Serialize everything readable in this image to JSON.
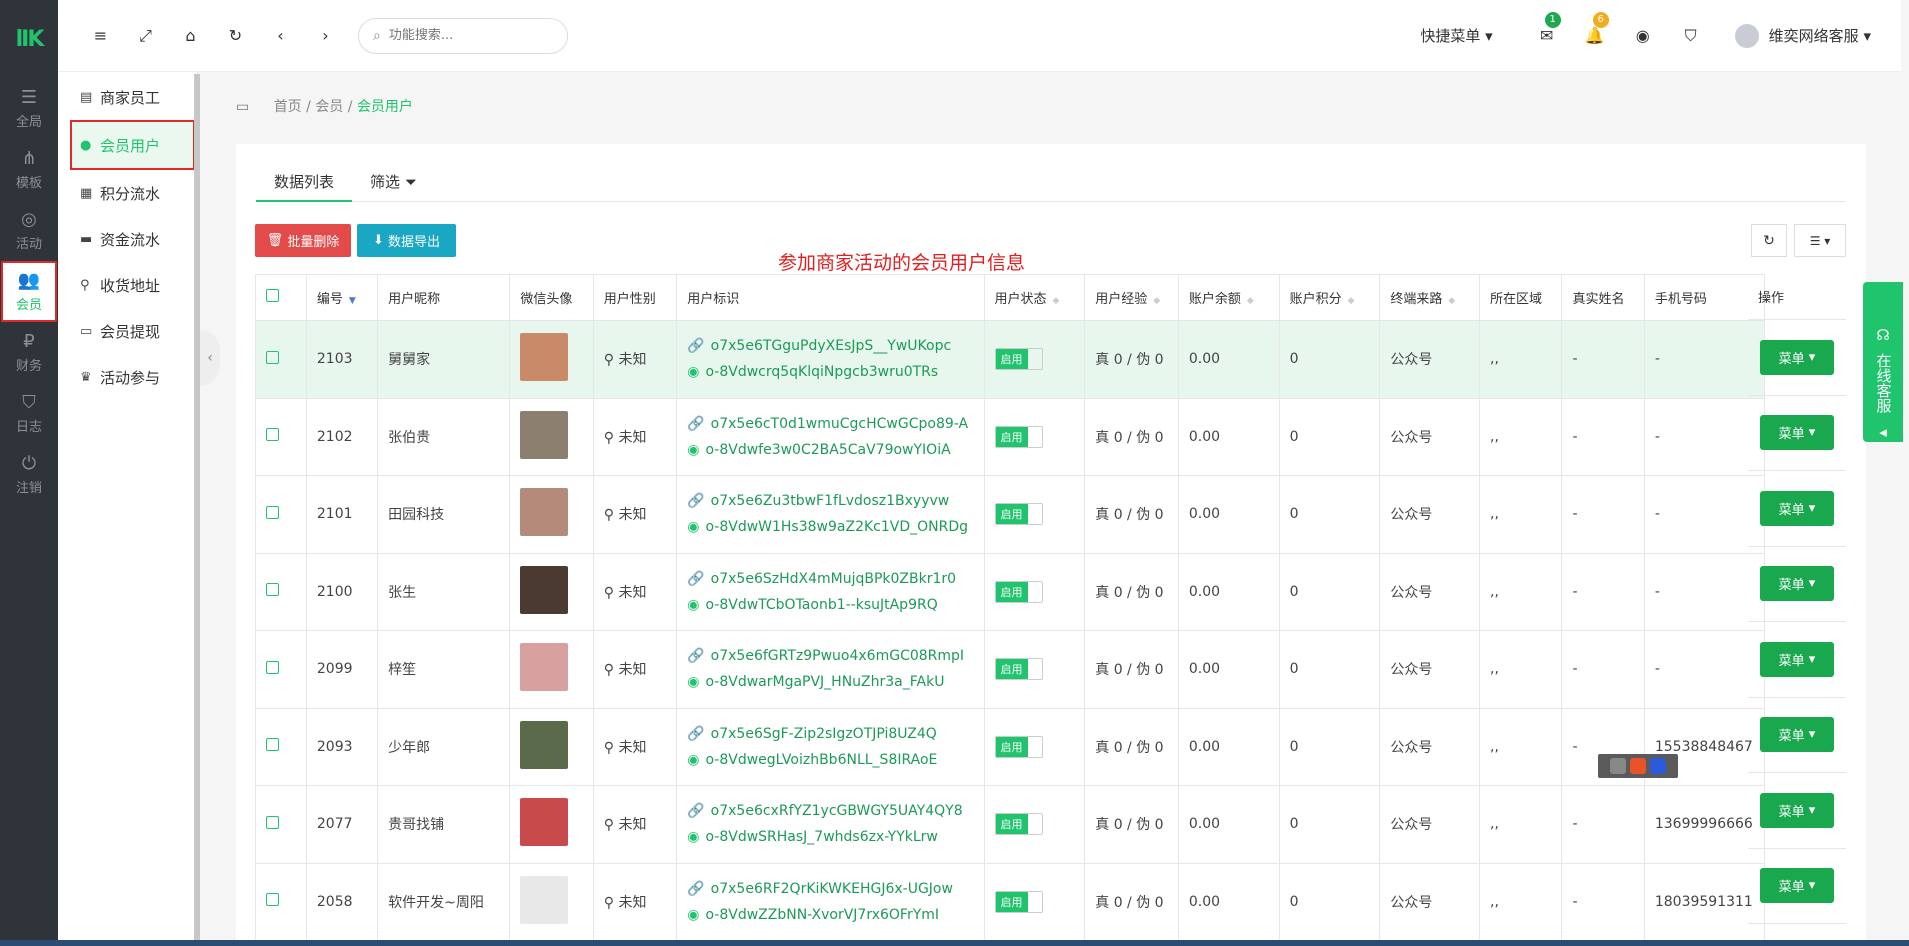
{
  "logo_text": "lIK",
  "rail": [
    {
      "label": "全局",
      "icon": "sliders-icon"
    },
    {
      "label": "模板",
      "icon": "sitemap-icon"
    },
    {
      "label": "活动",
      "icon": "broadcast-icon"
    },
    {
      "label": "会员",
      "icon": "users-icon",
      "active": true
    },
    {
      "label": "财务",
      "icon": "finance-icon"
    },
    {
      "label": "日志",
      "icon": "shield-icon"
    },
    {
      "label": "注销",
      "icon": "power-icon"
    }
  ],
  "subnav": [
    {
      "label": "商家员工",
      "icon": "id-card-icon"
    },
    {
      "label": "会员用户",
      "icon": "user-icon",
      "active": true
    },
    {
      "label": "积分流水",
      "icon": "calculator-icon"
    },
    {
      "label": "资金流水",
      "icon": "book-icon"
    },
    {
      "label": "收货地址",
      "icon": "map-pin-icon"
    },
    {
      "label": "会员提现",
      "icon": "credit-card-icon"
    },
    {
      "label": "活动参与",
      "icon": "trophy-icon"
    }
  ],
  "header": {
    "search_placeholder": "功能搜索...",
    "quick_menu": "快捷菜单",
    "mail_badge": "1",
    "bell_badge": "6",
    "username": "维奕网络客服"
  },
  "breadcrumb": {
    "home": "首页",
    "sep": "/",
    "level1": "会员",
    "current": "会员用户"
  },
  "tabs": {
    "list": "数据列表",
    "filter": "筛选"
  },
  "toolbar": {
    "batch_delete": "批量删除",
    "export": "数据导出"
  },
  "annotation": "参加商家活动的会员用户信息",
  "columns": [
    "编号",
    "用户昵称",
    "微信头像",
    "用户性别",
    "用户标识",
    "用户状态",
    "用户经验",
    "账户余额",
    "账户积分",
    "终端来路",
    "所在区域",
    "真实姓名",
    "手机号码"
  ],
  "op_header": "操作",
  "rows": [
    {
      "id": "2103",
      "nick": "舅舅家",
      "gender": "未知",
      "id1": "o7x5e6TGguPdyXEsJpS__YwUKopc",
      "id2": "o-8Vdwcrq5qKlqiNpgcb3wru0TRs",
      "status": "启用",
      "exp": "真 0 / 伪 0",
      "balance": "0.00",
      "points": "0",
      "source": "公众号",
      "region": ",,",
      "realname": "-",
      "phone": "-",
      "avatar_color": "#c98a6a"
    },
    {
      "id": "2102",
      "nick": "张伯贵",
      "gender": "未知",
      "id1": "o7x5e6cT0d1wmuCgcHCwGCpo89-A",
      "id2": "o-8Vdwfe3w0C2BA5CaV79owYIOiA",
      "status": "启用",
      "exp": "真 0 / 伪 0",
      "balance": "0.00",
      "points": "0",
      "source": "公众号",
      "region": ",,",
      "realname": "-",
      "phone": "-",
      "avatar_color": "#8d7f6f"
    },
    {
      "id": "2101",
      "nick": "田园科技",
      "gender": "未知",
      "id1": "o7x5e6Zu3tbwF1fLvdosz1Bxyyvw",
      "id2": "o-8VdwW1Hs38w9aZ2Kc1VD_ONRDg",
      "status": "启用",
      "exp": "真 0 / 伪 0",
      "balance": "0.00",
      "points": "0",
      "source": "公众号",
      "region": ",,",
      "realname": "-",
      "phone": "-",
      "avatar_color": "#b48a7a"
    },
    {
      "id": "2100",
      "nick": "张生",
      "gender": "未知",
      "id1": "o7x5e6SzHdX4mMujqBPk0ZBkr1r0",
      "id2": "o-8VdwTCbOTaonb1--ksuJtAp9RQ",
      "status": "启用",
      "exp": "真 0 / 伪 0",
      "balance": "0.00",
      "points": "0",
      "source": "公众号",
      "region": ",,",
      "realname": "-",
      "phone": "-",
      "avatar_color": "#4a3a30"
    },
    {
      "id": "2099",
      "nick": "梓笙",
      "gender": "未知",
      "id1": "o7x5e6fGRTz9Pwuo4x6mGC08RmpI",
      "id2": "o-8VdwarMgaPVJ_HNuZhr3a_FAkU",
      "status": "启用",
      "exp": "真 0 / 伪 0",
      "balance": "0.00",
      "points": "0",
      "source": "公众号",
      "region": ",,",
      "realname": "-",
      "phone": "-",
      "avatar_color": "#d9a0a0"
    },
    {
      "id": "2093",
      "nick": "少年郎",
      "gender": "未知",
      "id1": "o7x5e6SgF-Zip2sIgzOTJPi8UZ4Q",
      "id2": "o-8VdwegLVoizhBb6NLL_S8IRAoE",
      "status": "启用",
      "exp": "真 0 / 伪 0",
      "balance": "0.00",
      "points": "0",
      "source": "公众号",
      "region": ",,",
      "realname": "-",
      "phone": "15538848467",
      "avatar_color": "#5a6a4a"
    },
    {
      "id": "2077",
      "nick": "贵哥找铺",
      "gender": "未知",
      "id1": "o7x5e6cxRfYZ1ycGBWGY5UAY4QY8",
      "id2": "o-8VdwSRHasJ_7whds6zx-YYkLrw",
      "status": "启用",
      "exp": "真 0 / 伪 0",
      "balance": "0.00",
      "points": "0",
      "source": "公众号",
      "region": ",,",
      "realname": "-",
      "phone": "13699996666",
      "avatar_color": "#c84a4a"
    },
    {
      "id": "2058",
      "nick": "软件开发~周阳",
      "gender": "未知",
      "id1": "o7x5e6RF2QrKiKWKEHGJ6x-UGJow",
      "id2": "o-8VdwZZbNN-XvorVJ7rx6OFrYmI",
      "status": "启用",
      "exp": "真 0 / 伪 0",
      "balance": "0.00",
      "points": "0",
      "source": "公众号",
      "region": ",,",
      "realname": "-",
      "phone": "18039591311",
      "avatar_color": "#e8e8e8"
    }
  ],
  "menu_label": "菜单",
  "kefu_label": "在线客服",
  "colors": {
    "accent": "#1fc46c",
    "danger": "#e34b4b",
    "info": "#1aa7c4",
    "rail_bg": "#2f343a"
  }
}
